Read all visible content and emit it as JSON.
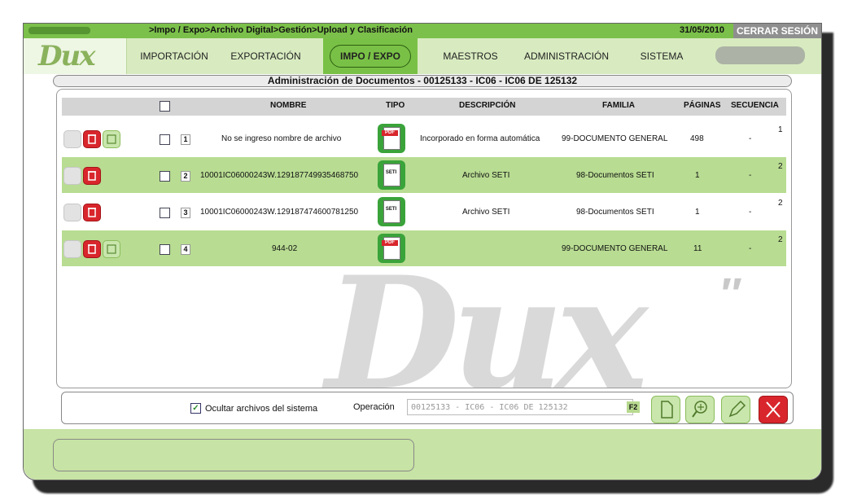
{
  "header": {
    "breadcrumb": ">Impo / Expo>Archivo Digital>Gestión>Upload y Clasificación",
    "date": "31/05/2010",
    "logout_label": "CERRAR SESIÓN"
  },
  "logo": {
    "text": "Dux"
  },
  "nav": {
    "items": [
      {
        "label": "IMPORTACIÓN"
      },
      {
        "label": "EXPORTACIÓN"
      },
      {
        "label": "IMPO / EXPO"
      },
      {
        "label": "MAESTROS"
      },
      {
        "label": "ADMINISTRACIÓN"
      },
      {
        "label": "SISTEMA"
      }
    ],
    "active": "IMPO / EXPO"
  },
  "doc_title": "Administración de Documentos - 00125133 - IC06 - IC06 DE 125132",
  "table": {
    "headers": {
      "nombre": "NOMBRE",
      "tipo": "TIPO",
      "descripcion": "DESCRIPCIÓN",
      "familia": "FAMILIA",
      "paginas": "PÁGINAS",
      "secuencia": "SECUENCIA"
    },
    "rows": [
      {
        "num": "1",
        "nombre": "No se ingreso nombre de archivo",
        "tipo": "pdf",
        "descripcion": "Incorporado en forma automática",
        "familia": "99-DOCUMENTO GENERAL",
        "paginas": "498",
        "secuencia": "-",
        "extra": "1"
      },
      {
        "num": "2",
        "nombre": "10001IC06000243W.129187749935468750",
        "tipo": "seti",
        "descripcion": "Archivo SETI",
        "familia": "98-Documentos SETI",
        "paginas": "1",
        "secuencia": "-",
        "extra": "2"
      },
      {
        "num": "3",
        "nombre": "10001IC06000243W.129187474600781250",
        "tipo": "seti",
        "descripcion": "Archivo SETI",
        "familia": "98-Documentos SETI",
        "paginas": "1",
        "secuencia": "-",
        "extra": "2"
      },
      {
        "num": "4",
        "nombre": "944-02",
        "tipo": "pdf",
        "descripcion": "",
        "familia": "99-DOCUMENTO GENERAL",
        "paginas": "11",
        "secuencia": "-",
        "extra": "2"
      }
    ]
  },
  "type_labels": {
    "pdf": "PDF",
    "seti": "SETI"
  },
  "bottom": {
    "hide_system_label": "Ocultar archivos del sistema",
    "hide_system_checked": true,
    "operation_label": "Operación",
    "operation_value": "00125133 - IC06 - IC06 DE 125132",
    "f2_label": "F2"
  },
  "colors": {
    "accent_green": "#79c146",
    "row_green": "#b8dc92",
    "delete_red": "#d8262c"
  }
}
